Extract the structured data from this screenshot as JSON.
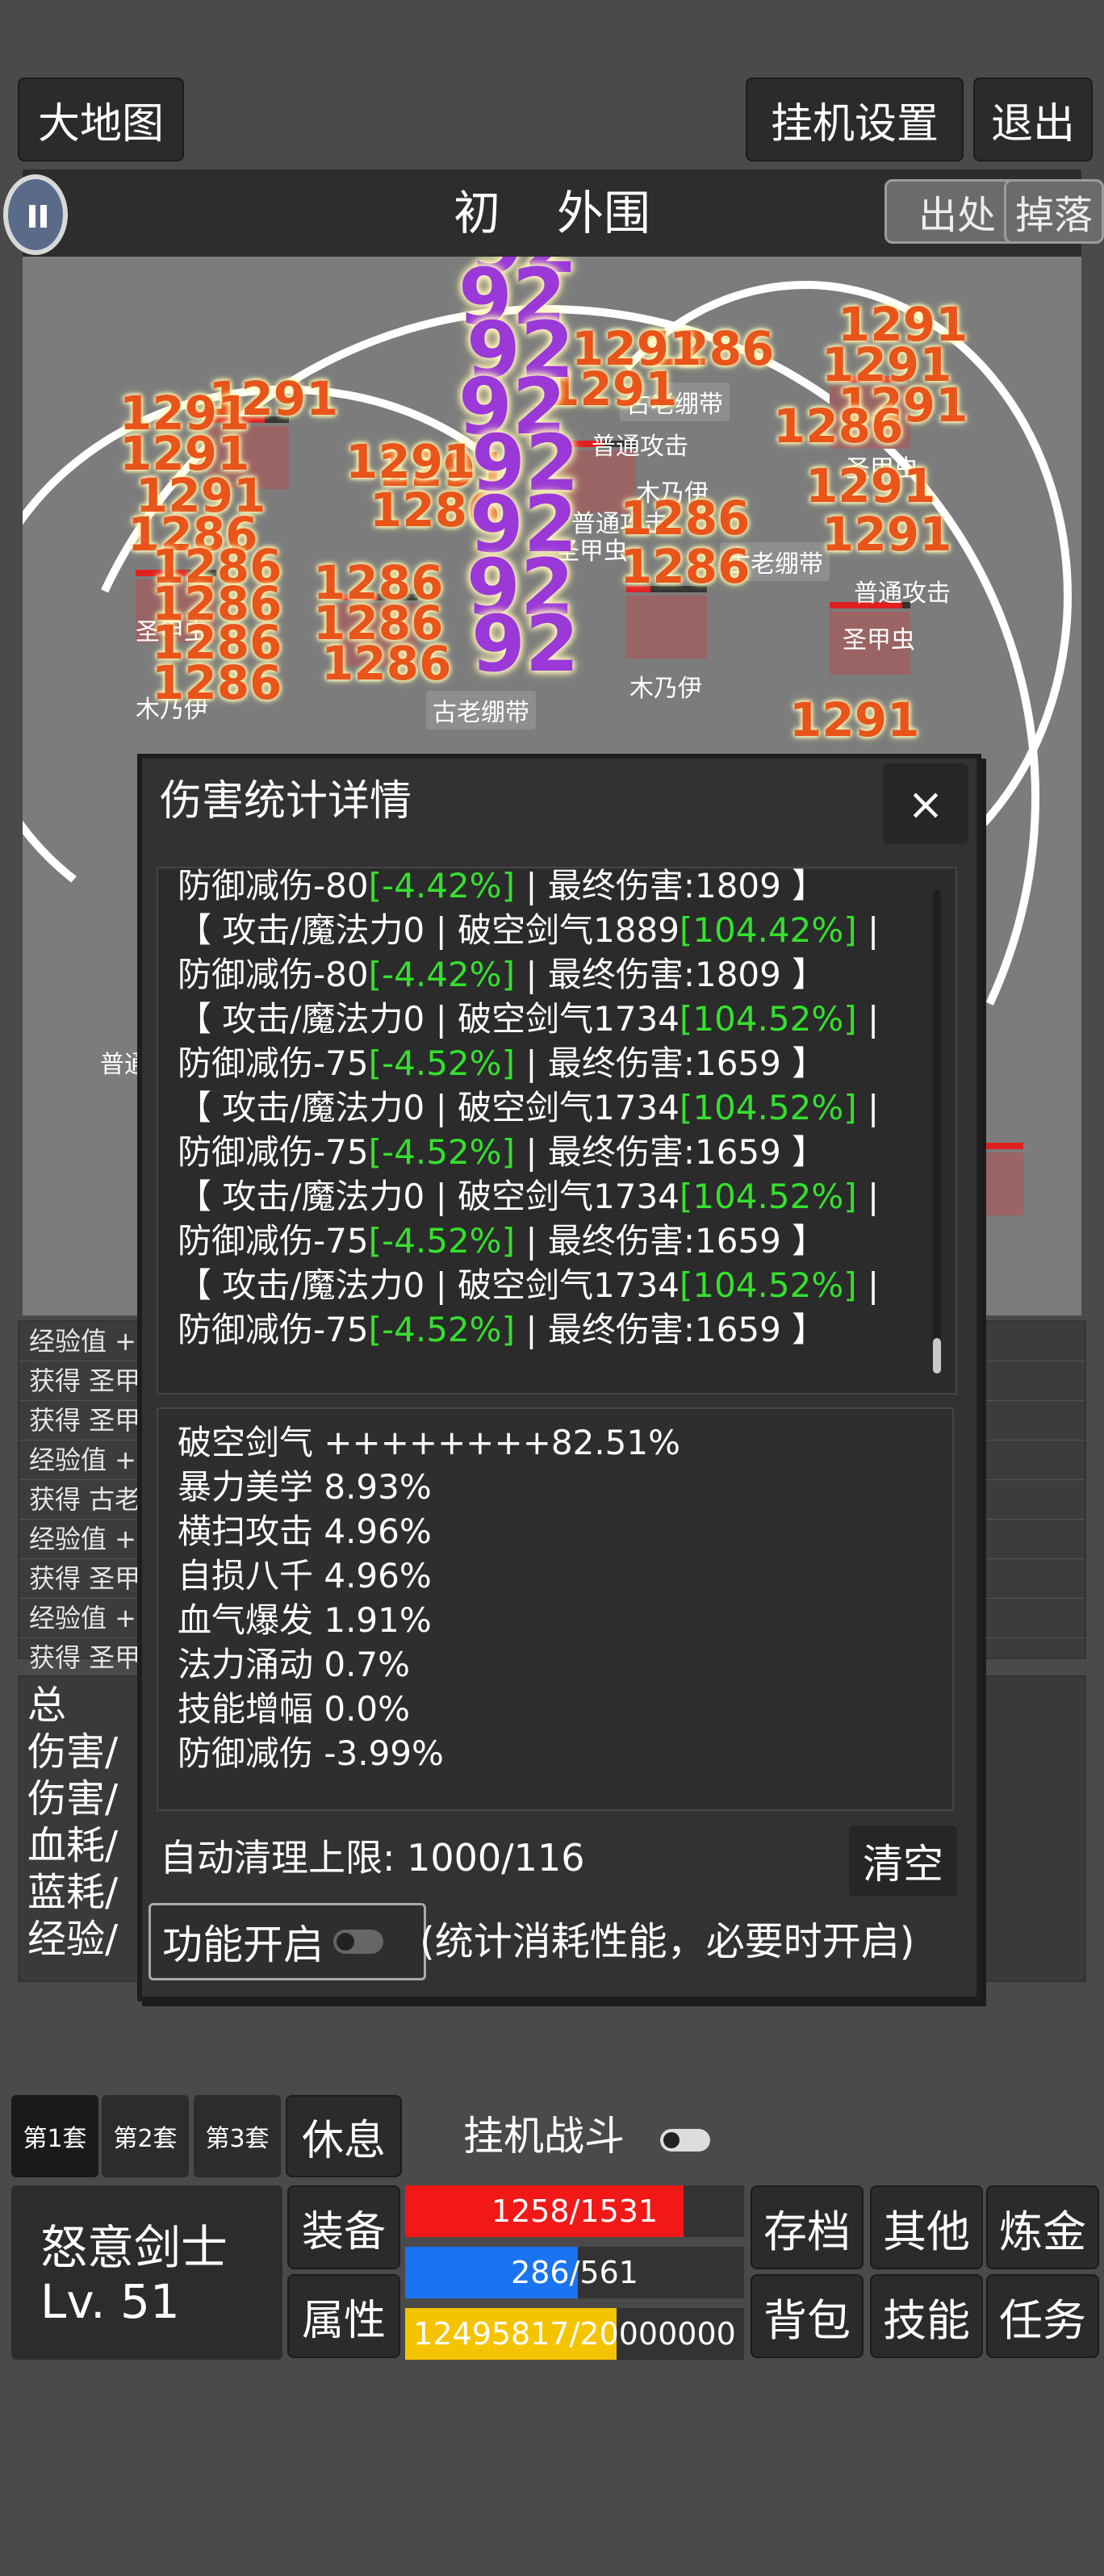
{
  "top_bar": {
    "map_label": "大地图",
    "idle_settings_label": "挂机设置",
    "exit_label": "退出"
  },
  "battlefield": {
    "area_title_left": "初",
    "area_title_right": "外围",
    "source_label": "出处",
    "drop_label": "掉落",
    "enemy_labels": [
      "古老绷带",
      "普通攻击",
      "木乃伊",
      "圣甲虫",
      "木乃伊",
      "圣甲虫",
      "古老绷带",
      "古老绷带",
      "普通攻击",
      "圣甲虫",
      "木乃伊",
      "普通攻击",
      "圣甲虫",
      "普通"
    ],
    "damage_numbers_small": [
      "1291",
      "1291",
      "1291",
      "1291",
      "1286",
      "1286",
      "1286",
      "1286",
      "1286",
      "1291",
      "1291",
      "1291",
      "1286",
      "1291",
      "1291",
      "1291",
      "1286",
      "1286",
      "1286",
      "1291",
      "1291",
      "1291",
      "1286",
      "1286",
      "1286",
      "1286",
      "1291"
    ],
    "damage_numbers_big": [
      "92",
      "92",
      "92",
      "92",
      "92",
      "92",
      "92",
      "92",
      "92"
    ]
  },
  "log": {
    "lines": [
      "经验值 +",
      "获得 圣甲",
      "获得 圣甲",
      "经验值 +",
      "获得 古老",
      "经验值 +",
      "获得 圣甲",
      "经验值 +",
      "获得 圣甲"
    ]
  },
  "stats_partial": {
    "lines": [
      "总",
      "伤害/",
      "伤害/",
      "血耗/",
      "蓝耗/",
      "经验/"
    ]
  },
  "modal": {
    "title": "伤害统计详情",
    "close_icon": "×",
    "records": [
      {
        "a": "防御减伤-80",
        "p": "[-4.42%]",
        "b": " | 最终伤害:1809 】"
      },
      {
        "a": "【 攻击/魔法力0 | 破空剑气1889",
        "p": "[104.42%]",
        "b": " |"
      },
      {
        "a": "防御减伤-80",
        "p": "[-4.42%]",
        "b": " | 最终伤害:1809 】"
      },
      {
        "a": "【 攻击/魔法力0 | 破空剑气1734",
        "p": "[104.52%]",
        "b": " |"
      },
      {
        "a": "防御减伤-75",
        "p": "[-4.52%]",
        "b": " | 最终伤害:1659 】"
      },
      {
        "a": "【 攻击/魔法力0 | 破空剑气1734",
        "p": "[104.52%]",
        "b": " |"
      },
      {
        "a": "防御减伤-75",
        "p": "[-4.52%]",
        "b": " | 最终伤害:1659 】"
      },
      {
        "a": "【 攻击/魔法力0 | 破空剑气1734",
        "p": "[104.52%]",
        "b": " |"
      },
      {
        "a": "防御减伤-75",
        "p": "[-4.52%]",
        "b": " | 最终伤害:1659 】"
      },
      {
        "a": "【 攻击/魔法力0 | 破空剑气1734",
        "p": "[104.52%]",
        "b": " |"
      },
      {
        "a": "防御减伤-75",
        "p": "[-4.52%]",
        "b": " | 最终伤害:1659 】"
      }
    ],
    "summary": [
      "破空剑气 ++++++++82.51%",
      "暴力美学 8.93%",
      "横扫攻击 4.96%",
      "自损八千 4.96%",
      "血气爆发 1.91%",
      "法力涌动 0.7%",
      "技能增幅 0.0%",
      "防御减伤 -3.99%"
    ],
    "auto_clear_label": "自动清理上限: 1000/116",
    "clear_label": "清空",
    "feature_label": "功能开启",
    "feature_note": "(统计消耗性能，必要时开启)"
  },
  "bottom": {
    "set_labels": [
      "第1套",
      "第2套",
      "第3套"
    ],
    "rest_label": "休息",
    "idle_fight_label": "挂机战斗",
    "char_name": "怒意剑士",
    "char_level": "Lv. 51",
    "equip_label": "装备",
    "attr_label": "属性",
    "hp_text": "1258/1531",
    "hp_fraction": 0.8217,
    "mp_text": "286/561",
    "mp_fraction": 0.5098,
    "xp_text": "12495817/20000000",
    "xp_fraction": 0.6248,
    "save_label": "存档",
    "other_label": "其他",
    "alchemy_label": "炼金",
    "bag_label": "背包",
    "skill_label": "技能",
    "quest_label": "任务"
  },
  "colors": {
    "hp": "#f21818",
    "mp": "#1a73f0",
    "xp": "#f5c400",
    "pct_green": "#35e02e",
    "big_damage": "#9a38d8"
  }
}
